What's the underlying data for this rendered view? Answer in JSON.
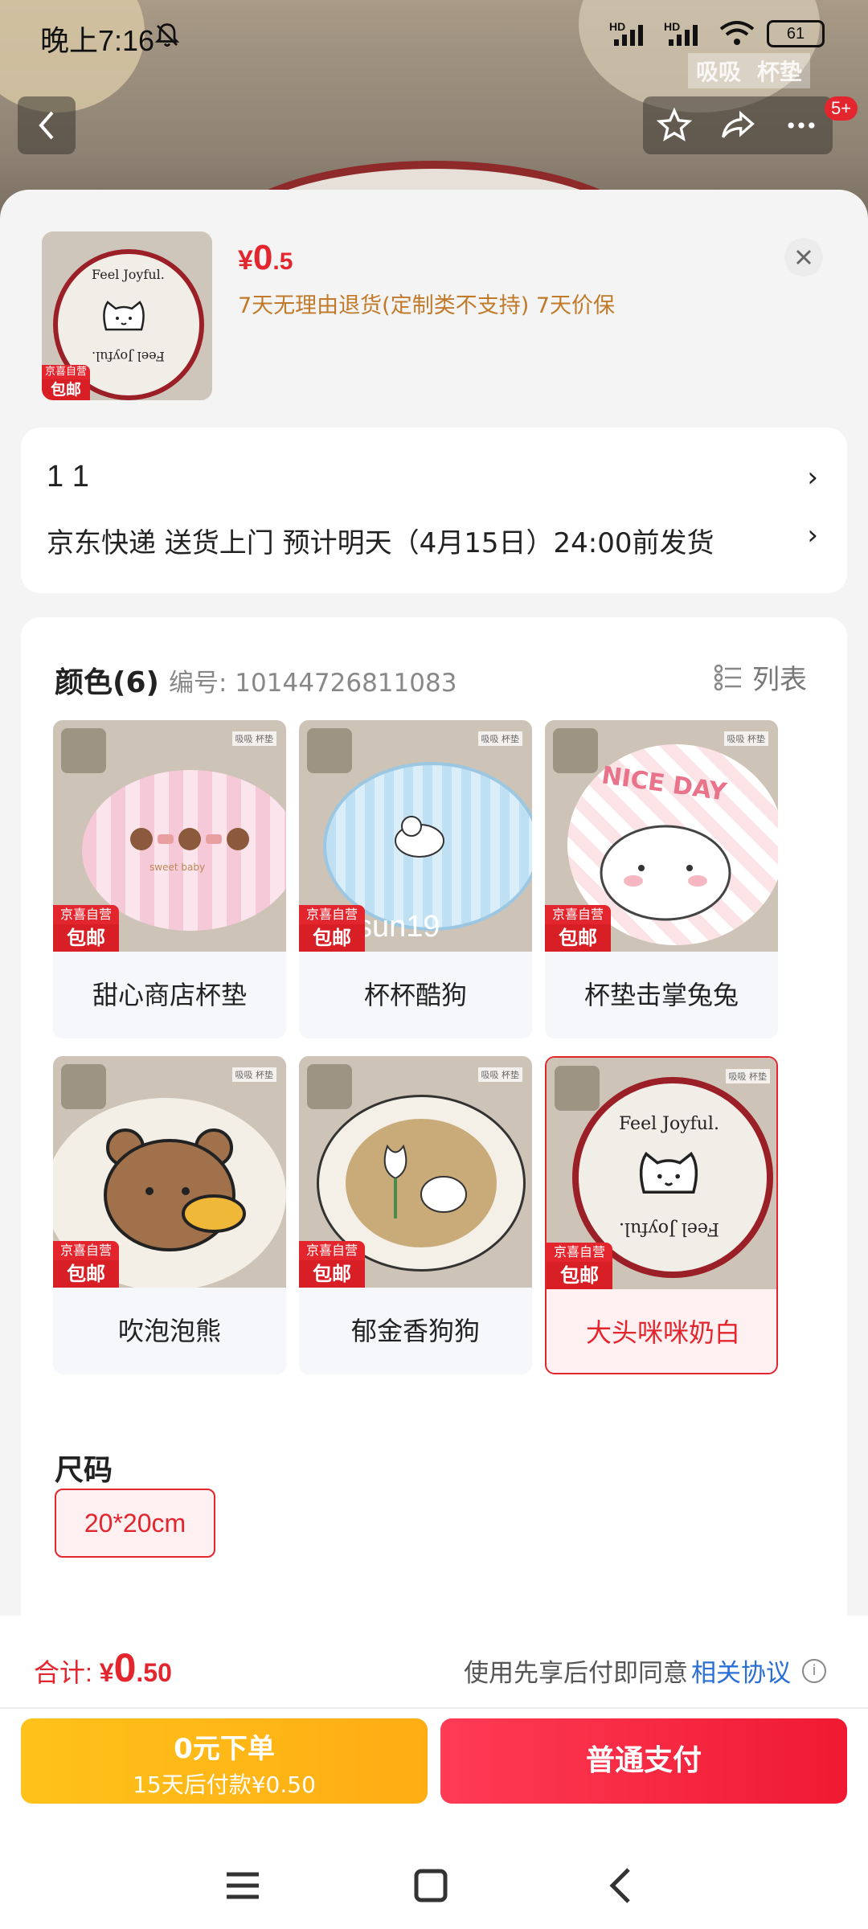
{
  "status": {
    "time": "晚上7:16",
    "battery": "61",
    "signal1": "HD",
    "signal2": "HD"
  },
  "watermark_tags": [
    "吸吸",
    "杯垫"
  ],
  "notif_badge": "5+",
  "product": {
    "price_currency": "¥",
    "price_int": "0",
    "price_dec": ".5",
    "service": "7天无理由退货(定制类不支持)  7天价保",
    "badge_top": "京喜自营",
    "badge_bottom": "包邮",
    "coaster_text_top": "Feel Joyful.",
    "coaster_text_bottom": "Feel Joyful."
  },
  "delivery": {
    "qty_line": "1  1",
    "shipping_line": "京东快递 送货上门 预计明天（4月15日）24:00前发货"
  },
  "color": {
    "title": "颜色(6)",
    "code": "编号: 10144726811083",
    "list_label": "列表",
    "options": [
      {
        "label": "甜心商店杯垫",
        "selected": false
      },
      {
        "label": "杯杯酷狗",
        "selected": false
      },
      {
        "label": "杯垫击掌兔兔",
        "selected": false
      },
      {
        "label": "吹泡泡熊",
        "selected": false
      },
      {
        "label": "郁金香狗狗",
        "selected": false
      },
      {
        "label": "大头咪咪奶白",
        "selected": true
      }
    ],
    "img_tags": "吸吸 杯垫",
    "badge_top": "京喜自营",
    "badge_bottom": "包邮",
    "nice_day": "NICE DAY",
    "sweet_baby": "sweet baby",
    "overlay_text": "sun19"
  },
  "size": {
    "title": "尺码",
    "options": [
      "20*20cm"
    ]
  },
  "footer": {
    "total_label": "合计: ",
    "total_currency": "¥",
    "total_int": "0",
    "total_dec": ".50",
    "agree_text": "使用先享后付即同意",
    "agree_link": "相关协议",
    "btn_later_l1": "0元下单",
    "btn_later_l2": "15天后付款¥0.50",
    "btn_pay": "普通支付"
  },
  "colors": {
    "accent": "#e3262e",
    "service": "#c07a2a",
    "link": "#2a6fd6",
    "gold": "#ffb81a"
  }
}
